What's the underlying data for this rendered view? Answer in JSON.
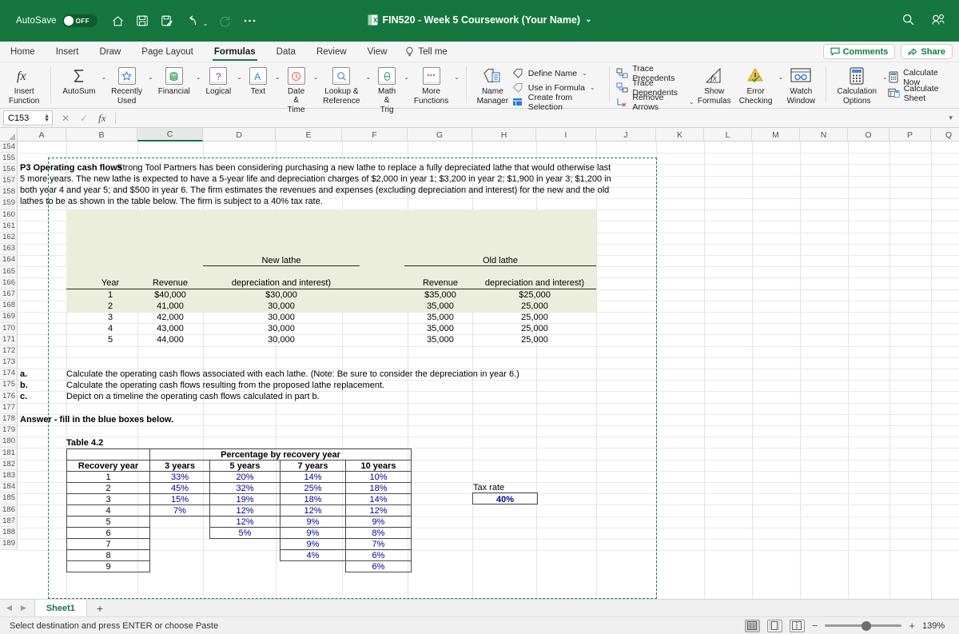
{
  "titlebar": {
    "autosave_label": "AutoSave",
    "autosave_state": "OFF",
    "document_title": "FIN520 - Week 5 Coursework (Your Name)",
    "title_caret": "⌄",
    "quick_access": [
      "home-icon",
      "save-icon",
      "save-as-icon",
      "undo-icon",
      "redo-icon",
      "more-icon"
    ],
    "right_icons": [
      "search-icon",
      "account-icon"
    ],
    "brand_color": "#15773f"
  },
  "tabs": [
    {
      "label": "Home",
      "active": false
    },
    {
      "label": "Insert",
      "active": false
    },
    {
      "label": "Draw",
      "active": false
    },
    {
      "label": "Page Layout",
      "active": false
    },
    {
      "label": "Formulas",
      "active": true
    },
    {
      "label": "Data",
      "active": false
    },
    {
      "label": "Review",
      "active": false
    },
    {
      "label": "View",
      "active": false
    }
  ],
  "tellme": "Tell me",
  "tab_right": [
    {
      "label": "Comments",
      "icon": "comment-icon"
    },
    {
      "label": "Share",
      "icon": "share-icon"
    }
  ],
  "ribbon": {
    "insert_function": "Insert\nFunction",
    "insert_function_l1": "Insert",
    "insert_function_l2": "Function",
    "library": [
      {
        "label_l1": "AutoSum",
        "label_l2": "",
        "icon": "sigma-icon"
      },
      {
        "label_l1": "Recently",
        "label_l2": "Used",
        "icon": "star-icon"
      },
      {
        "label_l1": "Financial",
        "label_l2": "",
        "icon": "coins-icon"
      },
      {
        "label_l1": "Logical",
        "label_l2": "",
        "icon": "question-icon"
      },
      {
        "label_l1": "Text",
        "label_l2": "",
        "icon": "letter-a-icon"
      },
      {
        "label_l1": "Date &",
        "label_l2": "Time",
        "icon": "clock-icon"
      },
      {
        "label_l1": "Lookup &",
        "label_l2": "Reference",
        "icon": "magnifier-icon"
      },
      {
        "label_l1": "Math &",
        "label_l2": "Trig",
        "icon": "theta-icon"
      },
      {
        "label_l1": "More",
        "label_l2": "Functions",
        "icon": "ellipsis-icon"
      }
    ],
    "name_manager_l1": "Name",
    "name_manager_l2": "Manager",
    "defined_names": [
      {
        "label": "Define Name",
        "icon": "tag-icon",
        "caret": true
      },
      {
        "label": "Use in Formula",
        "icon": "tag-formula-icon",
        "caret": true
      },
      {
        "label": "Create from Selection",
        "icon": "create-selection-icon",
        "caret": false
      }
    ],
    "auditing": [
      {
        "label": "Trace Precedents",
        "icon": "trace-precedents-icon",
        "caret": false
      },
      {
        "label": "Trace Dependents",
        "icon": "trace-dependents-icon",
        "caret": false
      },
      {
        "label": "Remove Arrows",
        "icon": "remove-arrows-icon",
        "caret": true
      }
    ],
    "show_formulas_l1": "Show",
    "show_formulas_l2": "Formulas",
    "error_checking_l1": "Error",
    "error_checking_l2": "Checking",
    "watch_window_l1": "Watch",
    "watch_window_l2": "Window",
    "calculation_options_l1": "Calculation",
    "calculation_options_l2": "Options",
    "calculate_now": "Calculate Now",
    "calculate_sheet": "Calculate Sheet"
  },
  "formula_bar": {
    "name_box_value": "C153",
    "formula_value": "",
    "cancel_icon": "cancel-icon",
    "confirm_icon": "confirm-icon",
    "fx_icon": "fx-icon"
  },
  "grid": {
    "columns": [
      "A",
      "B",
      "C",
      "D",
      "E",
      "F",
      "G",
      "H",
      "I",
      "J",
      "K",
      "L",
      "M",
      "N",
      "O",
      "P",
      "Q"
    ],
    "selected_column": "C",
    "rows": [
      154,
      155,
      156,
      157,
      158,
      159,
      160,
      161,
      162,
      163,
      164,
      165,
      166,
      167,
      168,
      169,
      170,
      171,
      172,
      173,
      174,
      175,
      176,
      177,
      178,
      179,
      180,
      181,
      182,
      183,
      184,
      185,
      186,
      187,
      188,
      189
    ]
  },
  "problem": {
    "title": "P3 Operating cash flows",
    "line1_rest": ". Strong Tool Partners has been considering purchasing a new lathe to replace a fully depreciated lathe that would otherwise last",
    "line2": "5 more years. The new lathe is expected to have a 5-year life and depreciation charges of $2,000 in year 1; $3,200 in year 2; $1,900 in year 3; $1,200 in",
    "line3": "both year 4 and year 5; and $500 in year 6. The firm estimates the revenues and expenses (excluding depreciation and interest) for the new and the old",
    "line4": "lathes to be as shown in the table below. The firm is subject to a 40% tax rate."
  },
  "lathe_table": {
    "new_lathe_header": "New lathe",
    "old_lathe_header": "Old lathe",
    "col_year": "Year",
    "col_revenue": "Revenue",
    "col_expenses": "depreciation and interest)",
    "rows": [
      {
        "year": "1",
        "new_revenue": "$40,000",
        "new_expenses": "$30,000",
        "old_revenue": "$35,000",
        "old_expenses": "$25,000"
      },
      {
        "year": "2",
        "new_revenue": "41,000",
        "new_expenses": "30,000",
        "old_revenue": "35,000",
        "old_expenses": "25,000"
      },
      {
        "year": "3",
        "new_revenue": "42,000",
        "new_expenses": "30,000",
        "old_revenue": "35,000",
        "old_expenses": "25,000"
      },
      {
        "year": "4",
        "new_revenue": "43,000",
        "new_expenses": "30,000",
        "old_revenue": "35,000",
        "old_expenses": "25,000"
      },
      {
        "year": "5",
        "new_revenue": "44,000",
        "new_expenses": "30,000",
        "old_revenue": "35,000",
        "old_expenses": "25,000"
      }
    ]
  },
  "questions": [
    {
      "letter": "a.",
      "text": "Calculate the operating cash flows associated with each lathe. (Note: Be sure to consider the depreciation in year 6.)"
    },
    {
      "letter": "b.",
      "text": "Calculate the operating cash flows resulting from the proposed lathe replacement."
    },
    {
      "letter": "c.",
      "text": "Depict on a timeline the operating cash flows calculated in part b."
    }
  ],
  "answer_prompt": "Answer - fill in the blue boxes below.",
  "table42": {
    "title": "Table 4.2",
    "span_header": "Percentage by recovery year",
    "col_recovery_year": "Recovery year",
    "columns": [
      "3 years",
      "5 years",
      "7 years",
      "10 years"
    ],
    "rows": [
      {
        "year": "1",
        "y3": "33%",
        "y5": "20%",
        "y7": "14%",
        "y10": "10%"
      },
      {
        "year": "2",
        "y3": "45%",
        "y5": "32%",
        "y7": "25%",
        "y10": "18%"
      },
      {
        "year": "3",
        "y3": "15%",
        "y5": "19%",
        "y7": "18%",
        "y10": "14%"
      },
      {
        "year": "4",
        "y3": "7%",
        "y5": "12%",
        "y7": "12%",
        "y10": "12%"
      },
      {
        "year": "5",
        "y3": "",
        "y5": "12%",
        "y7": "9%",
        "y10": "9%"
      },
      {
        "year": "6",
        "y3": "",
        "y5": "5%",
        "y7": "9%",
        "y10": "8%"
      },
      {
        "year": "7",
        "y3": "",
        "y5": "",
        "y7": "9%",
        "y10": "7%"
      },
      {
        "year": "8",
        "y3": "",
        "y5": "",
        "y7": "4%",
        "y10": "6%"
      },
      {
        "year": "9",
        "y3": "",
        "y5": "",
        "y7": "",
        "y10": "6%"
      }
    ]
  },
  "tax_rate": {
    "label": "Tax rate",
    "value": "40%"
  },
  "sheet_tabs": {
    "active_sheet": "Sheet1",
    "add_label": "+",
    "prev_icon": "prev-sheet-icon",
    "next_icon": "next-sheet-icon"
  },
  "status": {
    "message": "Select destination and press ENTER or choose Paste",
    "views": [
      "normal-view-icon",
      "page-layout-icon",
      "page-break-icon"
    ],
    "zoom_minus": "−",
    "zoom_plus": "+",
    "zoom_value": "139%"
  }
}
